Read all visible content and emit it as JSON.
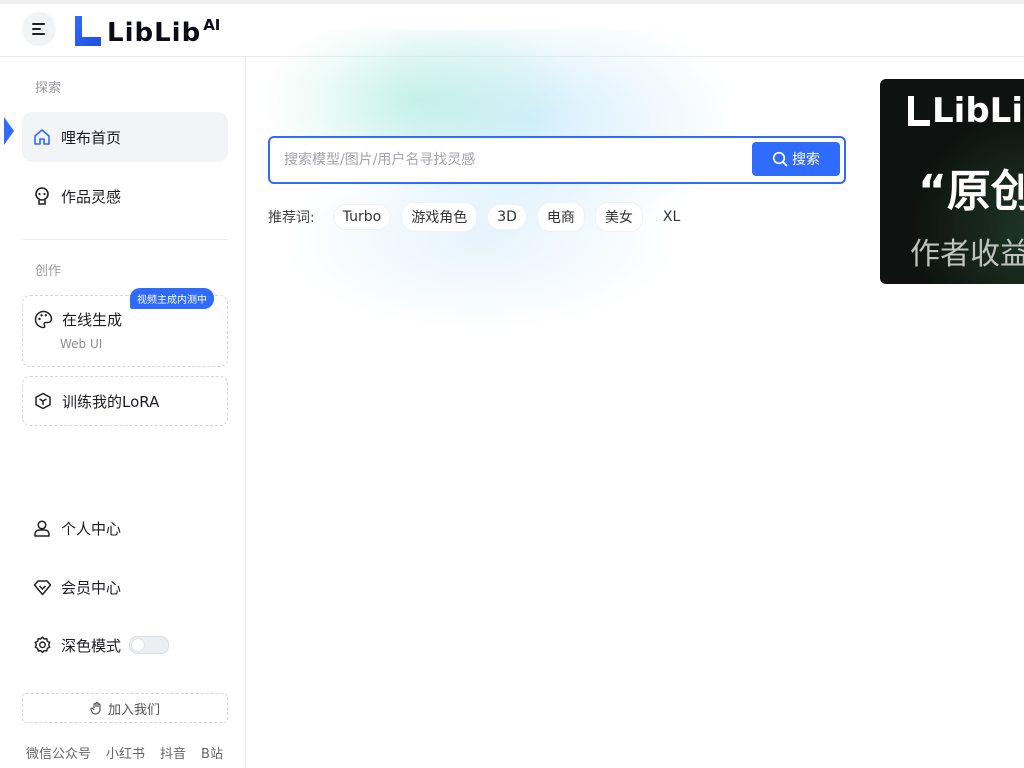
{
  "header": {
    "logo_text": "LibLib",
    "logo_ai": "AI"
  },
  "sidebar": {
    "section_explore": "探索",
    "home": "哩布首页",
    "inspiration": "作品灵感",
    "section_create": "创作",
    "online_gen": "在线生成",
    "online_gen_sub": "Web UI",
    "online_gen_badge": "视频主成内测中",
    "train_lora": "训练我的LoRA",
    "profile": "个人中心",
    "vip": "会员中心",
    "dark_mode": "深色模式",
    "dark_mode_on": false,
    "join": "加入我们",
    "footer_links": [
      "微信公众号",
      "小红书",
      "抖音",
      "B站"
    ]
  },
  "search": {
    "placeholder": "搜索模型/图片/用户名寻找灵感",
    "button": "搜索"
  },
  "tags": {
    "label": "推荐词:",
    "items": [
      "Turbo",
      "游戏角色",
      "3D",
      "电商",
      "美女",
      "XL"
    ]
  },
  "banner": {
    "logo": "LibLib",
    "quote": "“原创",
    "sub": "作者收益"
  },
  "colors": {
    "accent": "#2f6bff",
    "banner_bg": "#0e1210"
  }
}
